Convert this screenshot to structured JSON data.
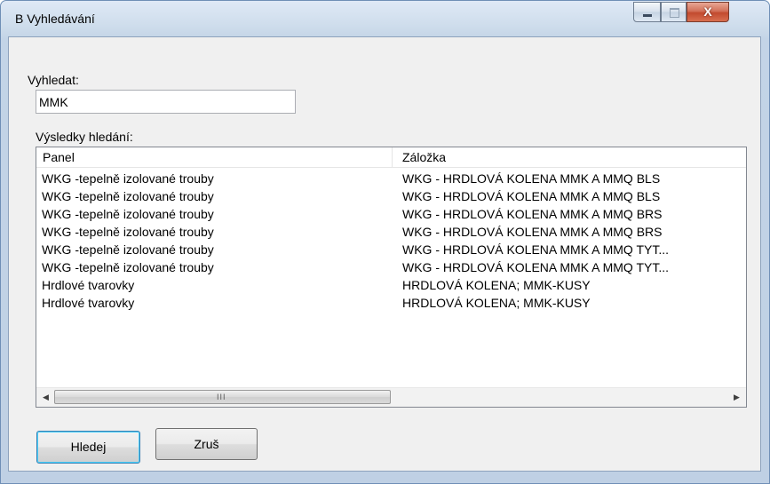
{
  "window": {
    "title": "B Vyhledávání",
    "close_glyph": "X"
  },
  "search": {
    "label": "Vyhledat:",
    "value": "MMK"
  },
  "results": {
    "label": "Výsledky hledání:",
    "columns": [
      "Panel",
      "Záložka"
    ],
    "rows": [
      [
        "WKG -tepelně izolované trouby",
        "WKG - HRDLOVÁ KOLENA MMK A MMQ BLS"
      ],
      [
        "WKG -tepelně izolované trouby",
        "WKG - HRDLOVÁ KOLENA MMK A MMQ BLS"
      ],
      [
        "WKG -tepelně izolované trouby",
        "WKG - HRDLOVÁ KOLENA MMK A MMQ BRS"
      ],
      [
        "WKG -tepelně izolované trouby",
        "WKG - HRDLOVÁ KOLENA MMK A MMQ BRS"
      ],
      [
        "WKG -tepelně izolované trouby",
        "WKG - HRDLOVÁ KOLENA MMK A MMQ TYT..."
      ],
      [
        "WKG -tepelně izolované trouby",
        "WKG - HRDLOVÁ KOLENA MMK A MMQ TYT..."
      ],
      [
        "Hrdlové tvarovky",
        "HRDLOVÁ KOLENA; MMK-KUSY"
      ],
      [
        "Hrdlové tvarovky",
        "HRDLOVÁ KOLENA; MMK-KUSY"
      ]
    ],
    "scrollbar": {
      "left_arrow": "◀",
      "right_arrow": "▶",
      "grip": "III"
    }
  },
  "buttons": {
    "search_label": "Hledej",
    "cancel_label": "Zruš"
  },
  "icons": {
    "minimize": "minimize-icon",
    "maximize": "maximize-icon",
    "close": "close-icon"
  }
}
